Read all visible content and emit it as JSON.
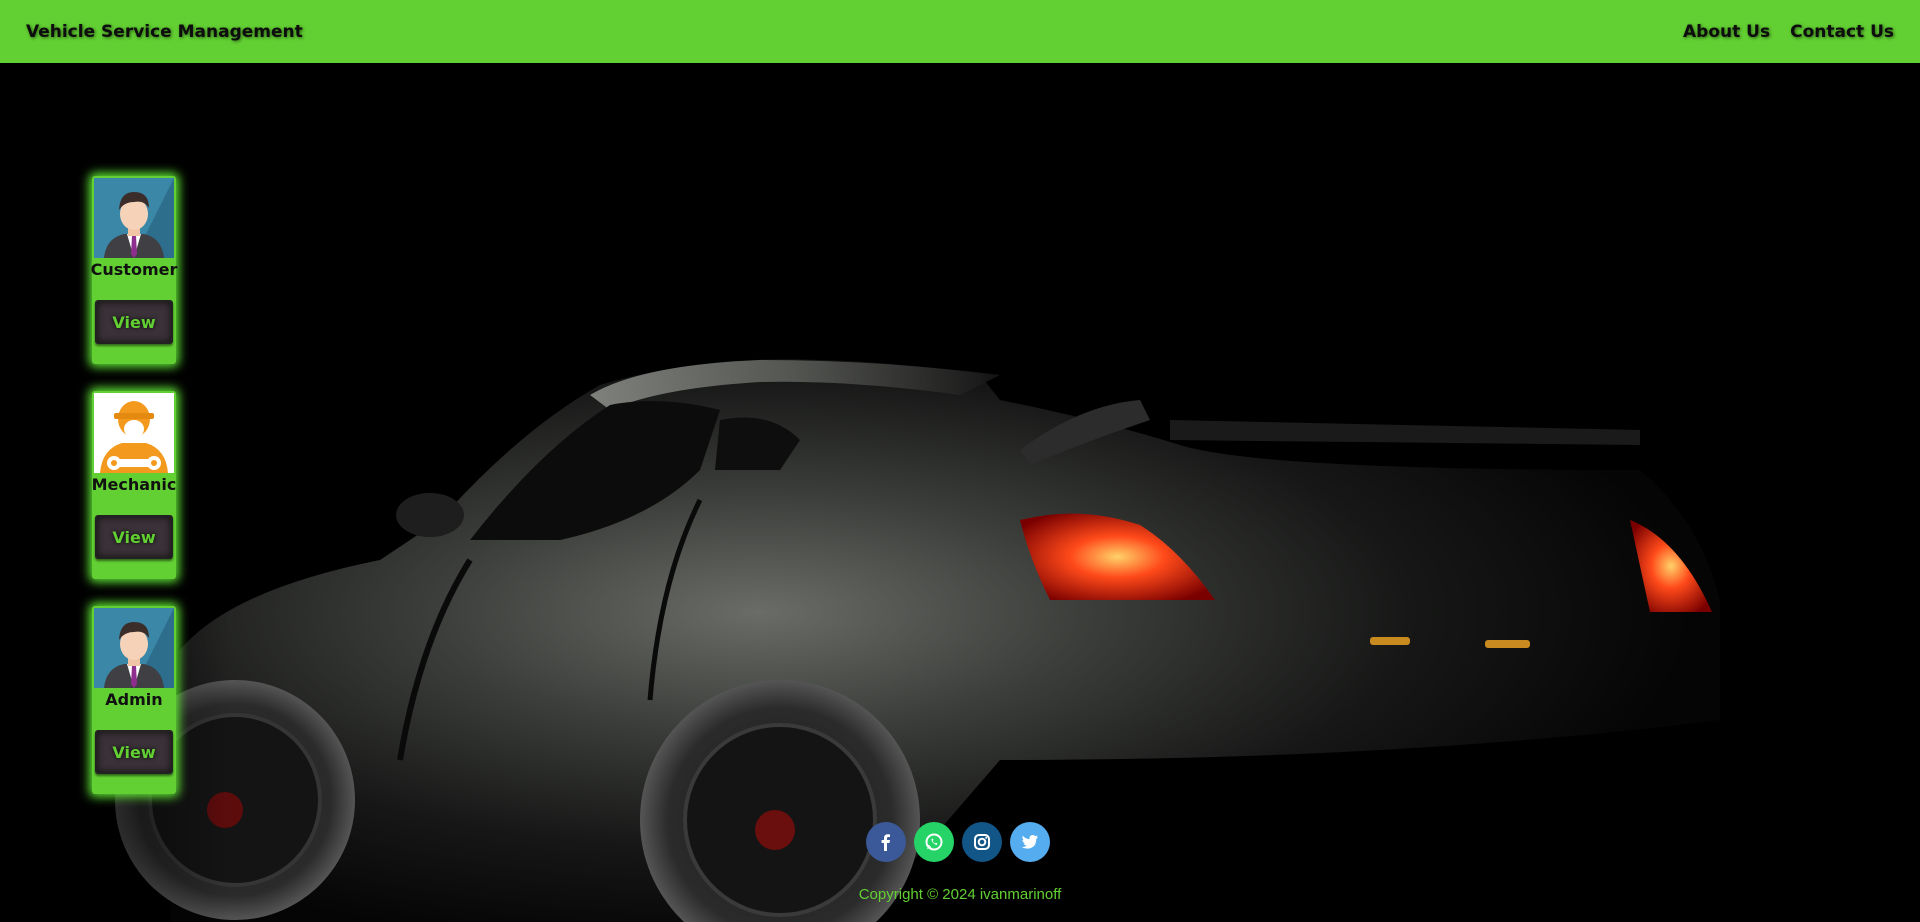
{
  "navbar": {
    "brand": "Vehicle Service Management",
    "links": [
      "About Us",
      "Contact Us"
    ]
  },
  "cards": [
    {
      "role": "Customer",
      "button": "View",
      "icon": "customer-avatar-icon"
    },
    {
      "role": "Mechanic",
      "button": "View",
      "icon": "mechanic-avatar-icon"
    },
    {
      "role": "Admin",
      "button": "View",
      "icon": "admin-avatar-icon"
    }
  ],
  "social": [
    {
      "icon": "facebook-icon",
      "color": "#3b5998"
    },
    {
      "icon": "whatsapp-icon",
      "color": "#25d366"
    },
    {
      "icon": "instagram-icon",
      "color": "#125688"
    },
    {
      "icon": "twitter-icon",
      "color": "#55acee"
    }
  ],
  "footer": {
    "copyright": "Copyright © 2024 ivanmarinoff"
  },
  "colors": {
    "accent": "#62d032",
    "background": "#000000",
    "button_bg": "#3a3238"
  }
}
